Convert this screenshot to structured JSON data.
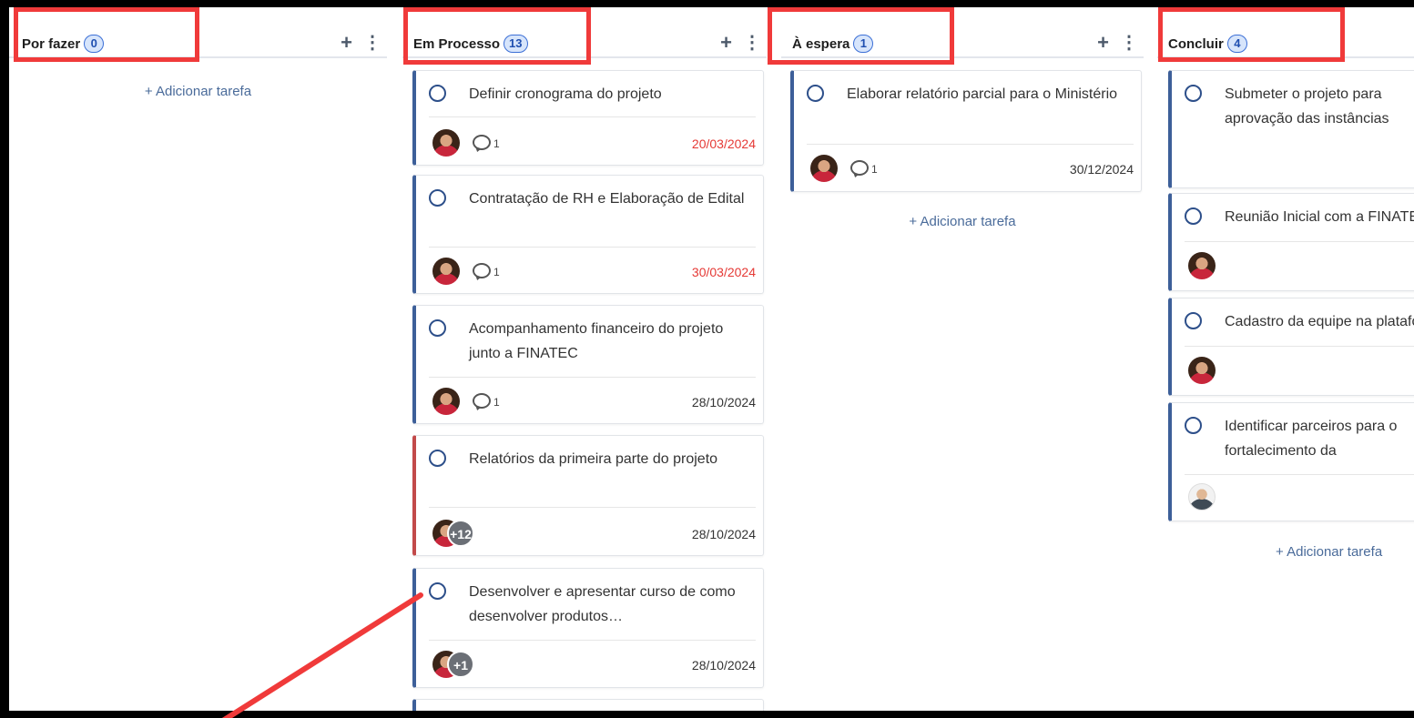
{
  "columns": [
    {
      "title": "Por fazer",
      "count": "0",
      "add_task": "+ Adicionar tarefa",
      "cards": []
    },
    {
      "title": "Em Processo",
      "count": "13",
      "cards": [
        {
          "title": "Definir cronograma do projeto",
          "comments": "1",
          "date": "20/03/2024"
        },
        {
          "title": "Contratação de RH e Elaboração de Edital",
          "comments": "1",
          "date": "30/03/2024"
        },
        {
          "title": "Acompanhamento financeiro do projeto junto a FINATEC",
          "comments": "1",
          "date": "28/10/2024"
        },
        {
          "title": "Relatórios da primeira parte do projeto",
          "more_avatars": "+12",
          "date": "28/10/2024"
        },
        {
          "title": "Desenvolver e apresentar curso de como desenvolver produtos…",
          "more_avatars": "+1",
          "date": "28/10/2024"
        }
      ]
    },
    {
      "title": "À espera",
      "count": "1",
      "add_task": "+ Adicionar tarefa",
      "cards": [
        {
          "title": "Elaborar relatório parcial para o Ministério",
          "comments": "1",
          "date": "30/12/2024"
        }
      ]
    },
    {
      "title": "Concluir",
      "count": "4",
      "add_task": "+ Adicionar tarefa",
      "cards": [
        {
          "title": "Submeter o projeto para aprovação das instâncias competentes"
        },
        {
          "title": "Reunião Inicial com a FINATEC"
        },
        {
          "title": "Cadastro da equipe na plataforma"
        },
        {
          "title": "Identificar parceiros para o fortalecimento da comunidade"
        }
      ]
    }
  ],
  "colors": {
    "accent": "#3d5f99",
    "overdue": "#e53935",
    "highlight": "#f03a3a"
  },
  "icons": {
    "add": "plus-icon",
    "menu": "more-vertical-icon",
    "task": "circle-check-icon",
    "comment": "comment-icon"
  }
}
